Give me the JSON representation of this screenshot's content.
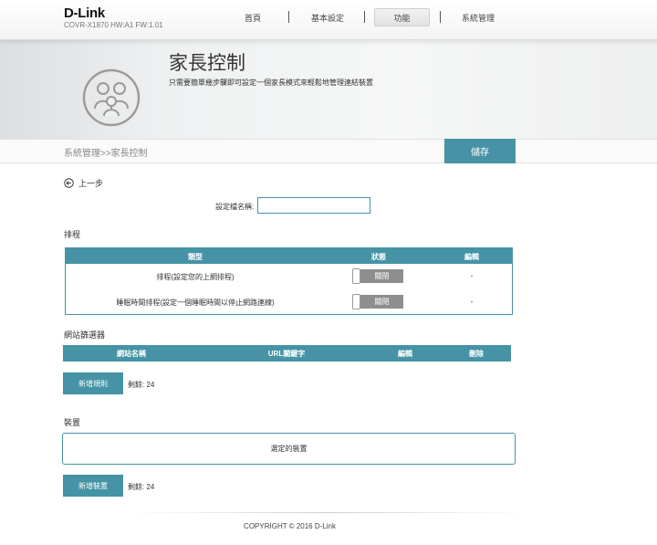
{
  "header": {
    "logo": "D-Link",
    "model_info": "COVR-X1870 HW:A1 FW:1.01",
    "nav": [
      {
        "label": "首頁"
      },
      {
        "label": "基本設定"
      },
      {
        "label": "功能"
      },
      {
        "label": "系統管理"
      }
    ],
    "active_nav": "功能"
  },
  "banner": {
    "title": "家長控制",
    "description": "只需要簡單幾步驟即可設定一個家長模式來輕鬆地管理連結裝置",
    "icon": "family-icon"
  },
  "breadcrumb": "系統管理>>家長控制",
  "save_label": "儲存",
  "back_label": "上一步",
  "rule_name": {
    "label": "設定檔名稱:",
    "value": ""
  },
  "schedule": {
    "title": "排程",
    "headers": [
      "類型",
      "狀態",
      "編輯"
    ],
    "rows": [
      {
        "type": "排程(設定您的上網排程)",
        "status": "關閉",
        "edit": "-"
      },
      {
        "type": "睡眠時間排程(設定一個睡眠時間以停止網路連線)",
        "status": "關閉",
        "edit": "-"
      }
    ]
  },
  "website_filter": {
    "title": "網站篩選器",
    "headers": [
      "網站名稱",
      "URL關鍵字",
      "編輯",
      "刪除"
    ],
    "add_label": "新增規則",
    "remaining": "剩餘: 24"
  },
  "devices": {
    "title": "裝置",
    "box_text": "選定的裝置",
    "add_label": "新增裝置",
    "remaining": "剩餘: 24"
  },
  "footer": {
    "copyright": "COPYRIGHT © 2016 D-Link"
  },
  "colors": {
    "accent": "#4593a5",
    "toggle_off": "#8e8e8e"
  }
}
